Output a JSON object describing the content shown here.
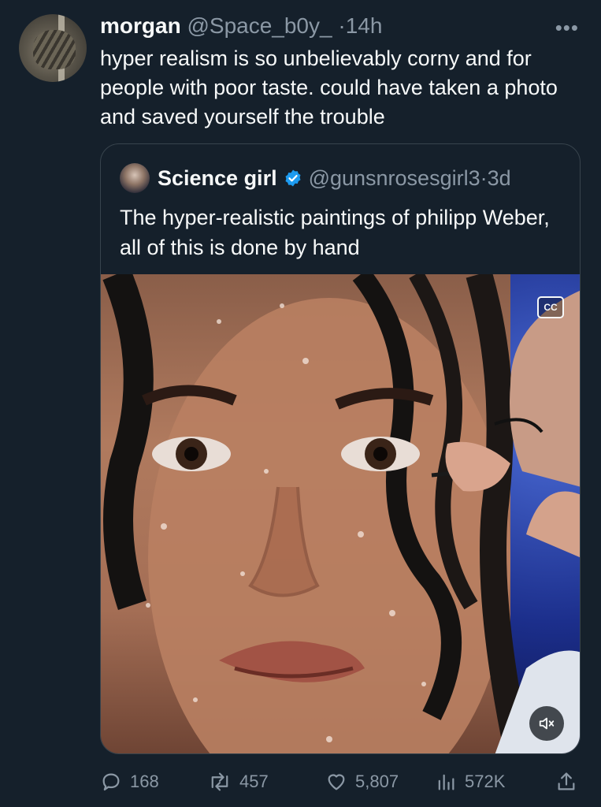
{
  "tweet": {
    "author_name": "morgan",
    "author_handle": "@Space_b0y_",
    "separator": "·",
    "time": "14h",
    "text": "hyper realism is so unbelievably corny and for people with poor taste. could have taken a photo and saved yourself the trouble",
    "more_icon": "more-horizontal-icon"
  },
  "quoted": {
    "author_name": "Science girl",
    "author_handle": "@gunsnrosesgirl3",
    "separator": "·",
    "time": "3d",
    "verified_icon": "verified-badge-icon",
    "text": "The hyper-realistic paintings of philipp Weber, all of this is done by hand",
    "media": {
      "caption_icon": "closed-captions-icon",
      "caption_label": "CC",
      "mute_icon": "volume-muted-icon"
    }
  },
  "actions": {
    "replies": "168",
    "retweets": "457",
    "likes": "5,807",
    "views": "572K"
  },
  "colors": {
    "background": "#15202b",
    "text": "#f7f9f9",
    "muted": "#8b98a5",
    "border": "#38444d",
    "verified": "#1d9bf0"
  }
}
